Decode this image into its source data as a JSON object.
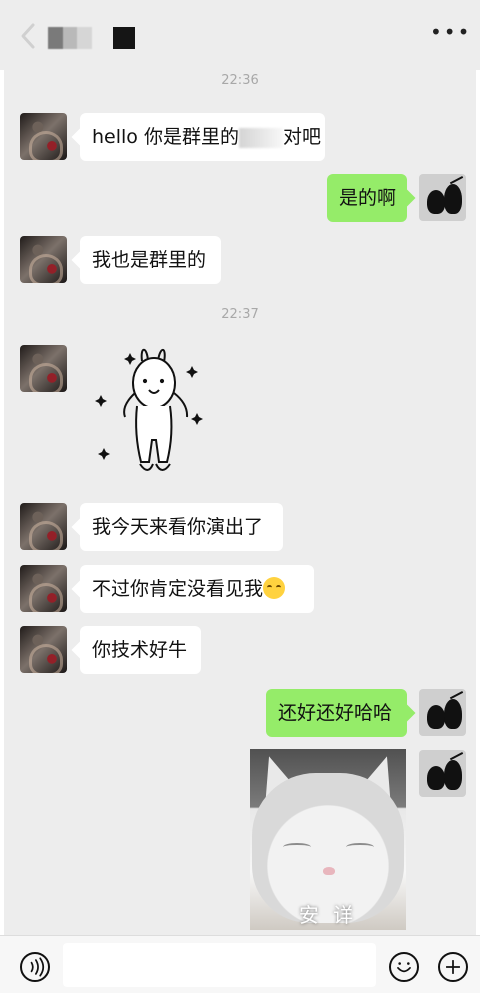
{
  "header": {
    "more_icon": "ellipsis-icon"
  },
  "timestamps": [
    "22:36",
    "22:37"
  ],
  "messages": [
    {
      "id": "m1",
      "side": "left",
      "text_prefix": "hello 你是群里的",
      "text_suffix": "对吧"
    },
    {
      "id": "m2",
      "side": "right",
      "text": "是的啊"
    },
    {
      "id": "m3",
      "side": "left",
      "text": "我也是群里的"
    },
    {
      "id": "m4",
      "side": "left",
      "type": "sticker"
    },
    {
      "id": "m5",
      "side": "left",
      "text": "我今天来看你演出了"
    },
    {
      "id": "m6",
      "side": "left",
      "text": "不过你肯定没看见我"
    },
    {
      "id": "m7",
      "side": "left",
      "text": "你技术好牛"
    },
    {
      "id": "m8",
      "side": "right",
      "text": "还好还好哈哈"
    },
    {
      "id": "m9",
      "side": "right",
      "type": "image",
      "caption": "安 详"
    }
  ],
  "input_bar": {
    "voice_icon": "voice-icon",
    "emoji_icon": "emoji-icon",
    "plus_icon": "plus-icon"
  },
  "colors": {
    "background": "#ededed",
    "incoming_bubble": "#ffffff",
    "outgoing_bubble": "#95ec69",
    "timestamp": "#a8a8a8"
  }
}
